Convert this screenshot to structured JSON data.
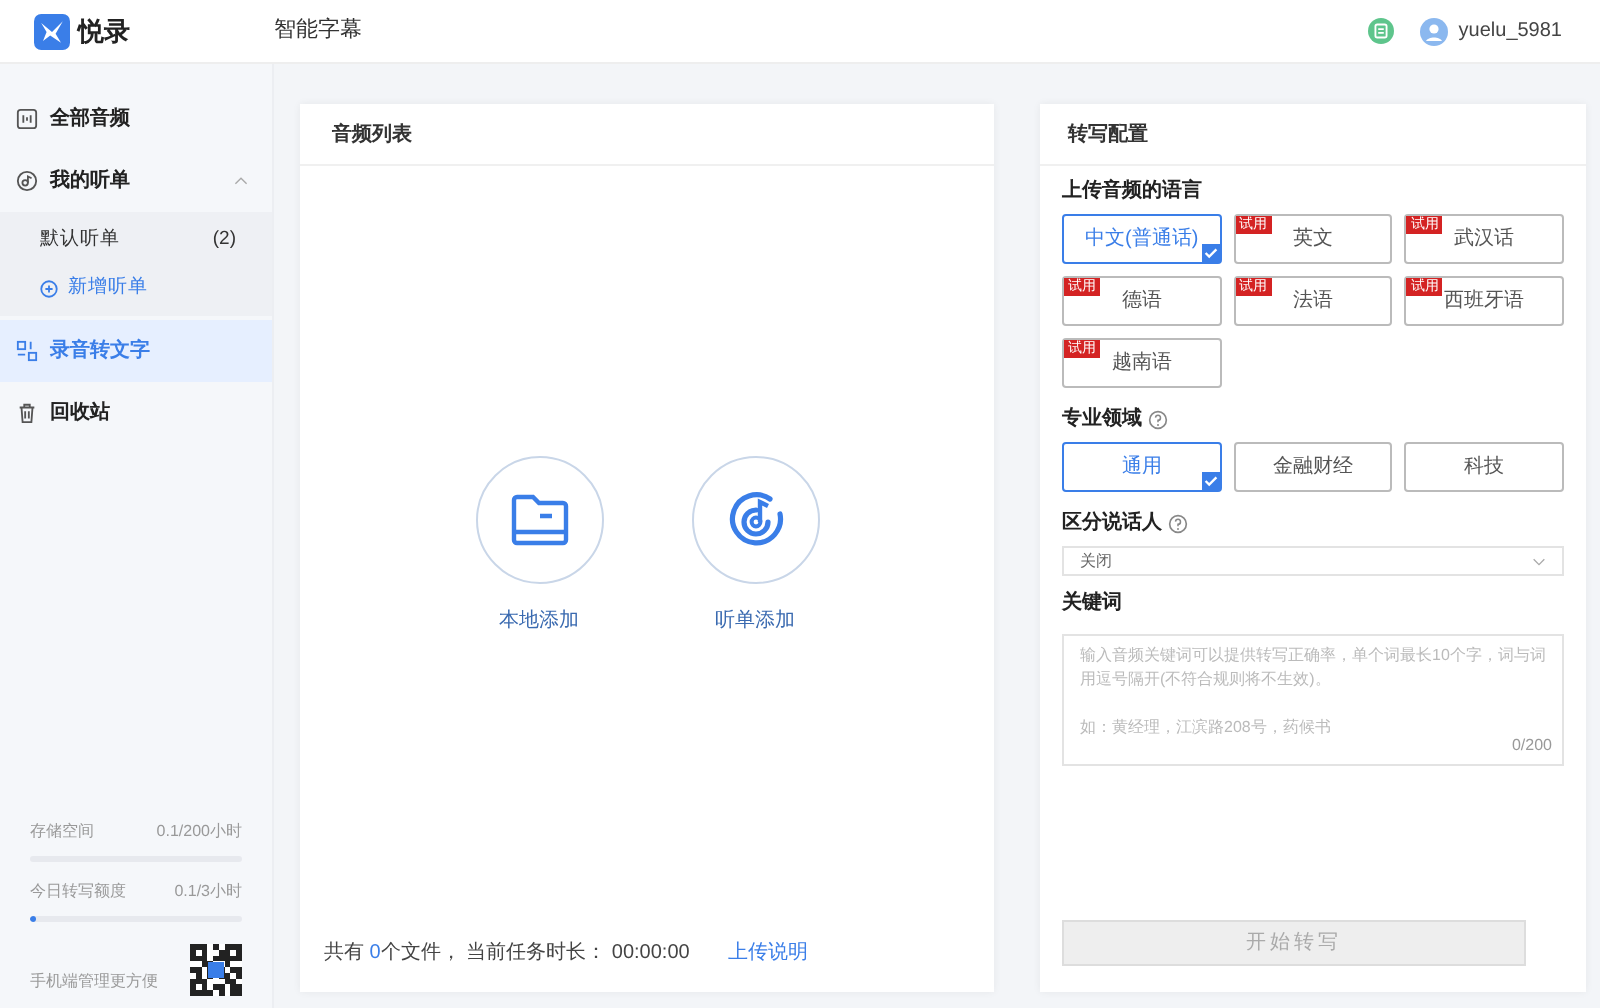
{
  "header": {
    "logo_text": "悦录",
    "nav": "智能字幕",
    "username": "yuelu_5981"
  },
  "sidebar": {
    "items": [
      {
        "kind": "link",
        "label": "全部音频",
        "selected": false
      },
      {
        "kind": "group",
        "label": "我的听单",
        "selected": false,
        "expanded": true,
        "children": [
          {
            "kind": "list",
            "label": "默认听单",
            "count": "(2)"
          },
          {
            "kind": "add",
            "label": "新增听单"
          }
        ]
      },
      {
        "kind": "link",
        "label": "录音转文字",
        "selected": true
      },
      {
        "kind": "trash",
        "label": "回收站",
        "selected": false
      }
    ],
    "quotas": [
      {
        "label": "存储空间",
        "value": "0.1/200小时",
        "level": 0.0005
      },
      {
        "label": "今日转写额度",
        "value": "0.1/3小时",
        "level": 0.033
      }
    ],
    "mobile_hint": "手机端管理更方便"
  },
  "audio_list": {
    "title": "音频列表",
    "actions": [
      {
        "kind": "folder",
        "label": "本地添加"
      },
      {
        "kind": "disc",
        "label": "听单添加"
      }
    ],
    "summary": {
      "before": "共有",
      "count": "0",
      "after": "个文件，",
      "duration_label": "当前任务时长：",
      "duration": "00:00:00"
    },
    "help_link": "上传说明"
  },
  "config": {
    "title": "转写配置",
    "language_label": "上传音频的语言",
    "languages": [
      {
        "label": "中文(普通话)",
        "selected": true
      },
      {
        "label": "英文",
        "selected": false,
        "badge": "试用"
      },
      {
        "label": "武汉话",
        "selected": false,
        "badge": "试用"
      },
      {
        "label": "德语",
        "selected": false,
        "badge": "试用"
      },
      {
        "label": "法语",
        "selected": false,
        "badge": "试用"
      },
      {
        "label": "西班牙语",
        "selected": false,
        "badge": "试用"
      },
      {
        "label": "越南语",
        "selected": false,
        "badge": "试用"
      }
    ],
    "domain_label": "专业领域",
    "domains": [
      {
        "label": "通用",
        "selected": true
      },
      {
        "label": "金融财经",
        "selected": false
      },
      {
        "label": "科技",
        "selected": false
      }
    ],
    "speaker_label": "区分说话人",
    "speaker_value": "关闭",
    "keyword_label": "关键词",
    "keyword_placeholder": [
      "输入音频关键词可以提供转写正确率，单个词最长10个字，词与词用逗号隔开(不符合规则将不生效)。",
      "如：黄经理，江滨路208号，药候书"
    ],
    "keyword_counter": "0/200",
    "start_button": {
      "label": "开始转写",
      "disabled": true
    }
  }
}
